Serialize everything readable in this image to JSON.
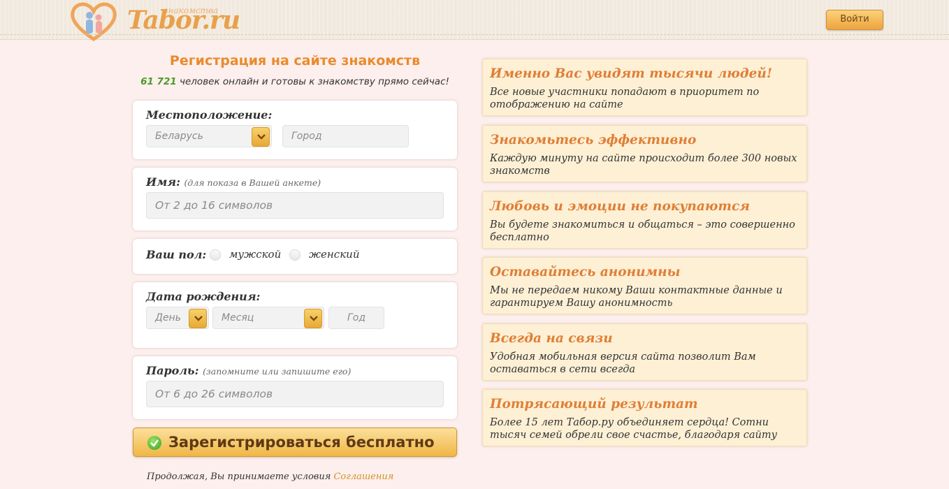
{
  "header": {
    "logo_text": "Tabor.ru",
    "logo_sub": "знакомства",
    "login_label": "Войти"
  },
  "registration": {
    "title": "Регистрация на сайте знакомств",
    "online_count": "61 721",
    "online_text": " человек онлайн и готовы к знакомству прямо сейчас!",
    "location": {
      "label": "Местоположение:",
      "country_value": "Беларусь",
      "city_placeholder": "Город"
    },
    "name": {
      "label": "Имя:",
      "hint": "(для показа в Вашей анкете)",
      "placeholder": "От 2 до 16 символов"
    },
    "gender": {
      "label": "Ваш пол:",
      "options": [
        "мужской",
        "женский"
      ]
    },
    "birthdate": {
      "label": "Дата рождения:",
      "day_placeholder": "День",
      "month_placeholder": "Месяц",
      "year_placeholder": "Год"
    },
    "password": {
      "label": "Пароль:",
      "hint": "(запомните или запишите его)",
      "placeholder": "От 6 до 26 символов"
    },
    "submit_label": "Зарегистрироваться бесплатно",
    "terms_text": "Продолжая, Вы принимаете условия ",
    "terms_link": "Соглашения"
  },
  "features": [
    {
      "title": "Именно Вас увидят тысячи людей!",
      "text": "Все новые участники попадают в приоритет по отображению на сайте"
    },
    {
      "title": "Знакомьтесь эффективно",
      "text": "Каждую минуту на сайте происходит более 300 новых знакомств"
    },
    {
      "title": "Любовь и эмоции не покупаются",
      "text": "Вы будете знакомиться и общаться – это совершенно бесплатно"
    },
    {
      "title": "Оставайтесь анонимны",
      "text": "Мы не передаем никому Ваши контактные данные и гарантируем Вашу анонимность"
    },
    {
      "title": "Всегда на связи",
      "text": "Удобная мобильная версия сайта позволит Вам оставаться в сети всегда"
    },
    {
      "title": "Потрясающий результат",
      "text": "Более 15 лет Табор.ру объединяет сердца! Сотни тысяч семей обрели свое счастье, благодаря сайту"
    }
  ],
  "colors": {
    "accent": "#e88b2d",
    "button_gradient_top": "#fbe09c",
    "button_gradient_bottom": "#f0b645",
    "online_count": "#4c9a2a",
    "feature_bg": "#fdf0d5",
    "page_bg": "#fcefed"
  },
  "icons": [
    "heart-logo-icon",
    "chevron-down-icon",
    "check-circle-icon"
  ]
}
